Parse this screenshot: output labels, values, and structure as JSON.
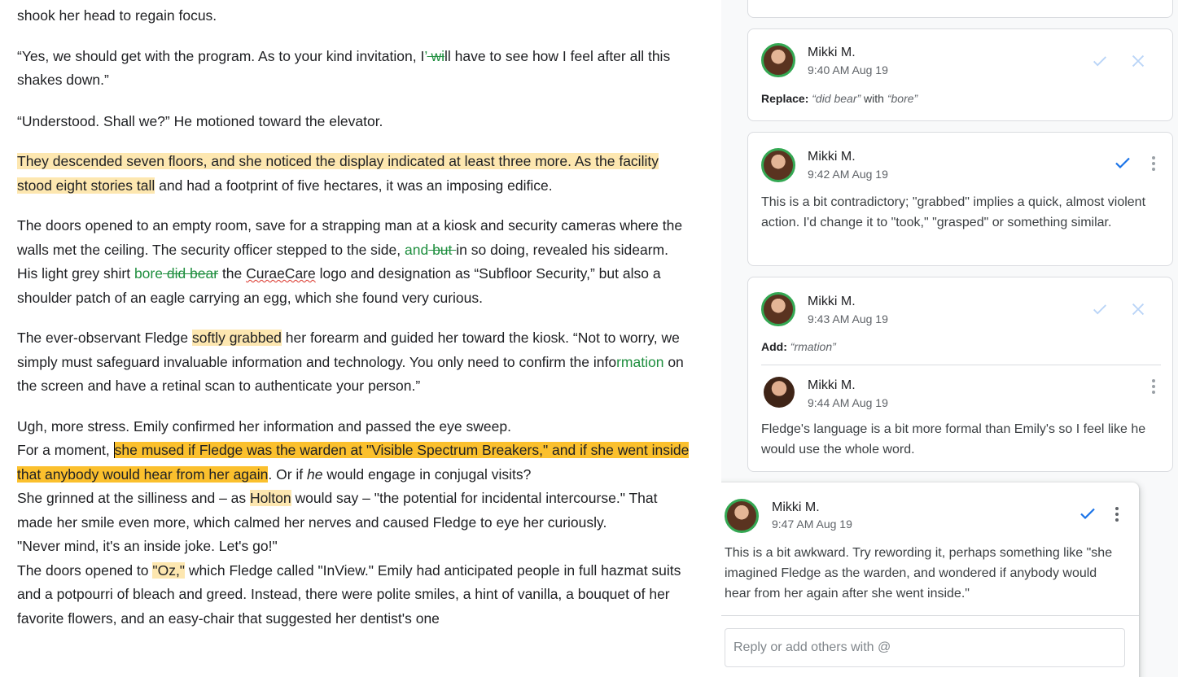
{
  "document": {
    "line_top": "shook her head to regain focus.",
    "p1_a": "“Yes, we should get with the program. As to your kind invitation, I",
    "p1_ins": "’",
    "p1_del": " wi",
    "p1_b": "ll have to see how I feel after all this shakes down.”",
    "p2": "“Understood. Shall we?” He motioned toward the elevator.",
    "p3_hl": "They descended seven floors, and she noticed the display indicated at least three more. As the facility stood eight stories tall",
    "p3_rest": " and had a footprint of five hectares, it was an imposing edifice.",
    "p4_a": "The doors opened to an empty room, save for a strapping man at a kiosk and security cameras where the walls met the ceiling. The security officer stepped to the side, ",
    "p4_ins1": "and",
    "p4_del1": " but ",
    "p4_b": "in so doing, revealed his sidearm. His light grey shirt ",
    "p4_ins2": "bore",
    "p4_del2": " did bear",
    "p4_c": " the ",
    "p4_spell": "CuraeCare",
    "p4_d": " logo and designation as “Subfloor Security,” but also a shoulder patch of an eagle carrying an egg, which she found very curious.",
    "p5_a": "The ever-observant Fledge ",
    "p5_hl": "softly grabbed",
    "p5_b": " her forearm and guided her toward the kiosk. “Not to worry, we simply must safeguard invaluable information and technology. You only need to confirm the info",
    "p5_ins": "rmation",
    "p5_c": " on the screen and have a retinal scan to authenticate your person.”",
    "p6_l1": "Ugh, more stress. Emily confirmed her information and passed the eye sweep.",
    "p6_a": "For a moment, ",
    "p6_hl": "she mused if Fledge was the warden at \"Visible Spectrum Breakers,\" and if she went inside that anybody would hear from her again",
    "p6_b": ". Or if ",
    "p6_i": "he",
    "p6_c": " would engage in conjugal visits?",
    "p6_d": "She grinned at the silliness and – as ",
    "p6_hl2": "Holton",
    "p6_e": " would say – \"the potential for incidental intercourse.\" That made her smile even more, which calmed her nerves and caused Fledge to eye her curiously.",
    "p6_l4": "\"Never mind, it's an inside joke. Let's go!\"",
    "p6_f": "The doors opened to ",
    "p6_hl3": "\"Oz,\"",
    "p6_g": " which Fledge called \"InView.\" Emily had anticipated people in full hazmat suits and a potpourri of bleach and greed. Instead, there were polite smiles, a hint of vanilla, a bouquet of her favorite flowers, and an easy-chair that suggested her dentist's one"
  },
  "comments": [
    {
      "author": "Mikki M.",
      "time": "9:40 AM Aug 19",
      "label": "Replace:",
      "from": "“did bear”",
      "with_word": " with ",
      "to": "“bore”"
    },
    {
      "author": "Mikki M.",
      "time": "9:42 AM Aug 19",
      "text": "This is a bit contradictory; \"grabbed\" implies a quick, almost violent action. I'd change it to \"took,\"  \"grasped\" or something similar."
    },
    {
      "author": "Mikki M.",
      "time": "9:43 AM Aug 19",
      "label": "Add:",
      "add": "“rmation”",
      "reply_author": "Mikki M.",
      "reply_time": "9:44 AM Aug 19",
      "reply_text": "Fledge's language is a bit more formal than Emily's so I feel like he would use the whole word."
    },
    {
      "author": "Mikki M.",
      "time": "9:47 AM Aug 19",
      "text": "This is a bit awkward. Try rewording it, perhaps something like \"she imagined Fledge as the warden, and wondered if anybody would hear from her again after she went inside.\"",
      "reply_placeholder": "Reply or add others with @"
    }
  ],
  "colors": {
    "highlight": "#fde7b0",
    "active_highlight": "#fbc02d",
    "suggestion": "#1e8e3e",
    "accent": "#1a73e8",
    "avatar_ring": "#34a853"
  }
}
